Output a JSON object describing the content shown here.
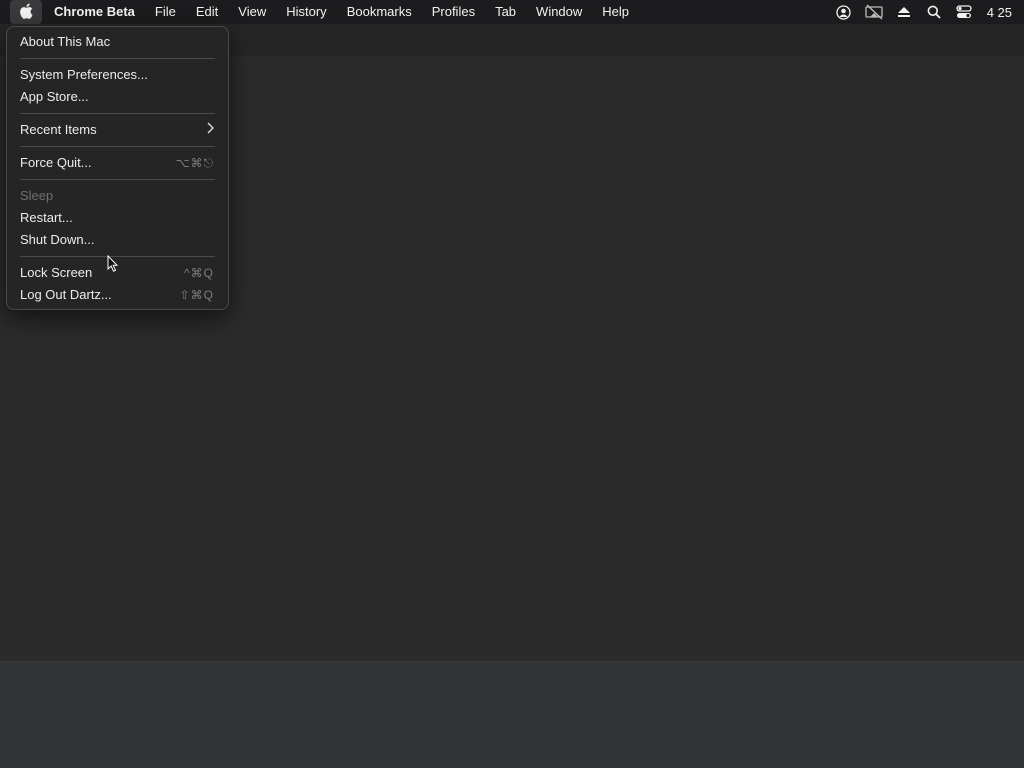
{
  "menubar": {
    "app_name": "Chrome Beta",
    "menus": [
      "File",
      "Edit",
      "View",
      "History",
      "Bookmarks",
      "Profiles",
      "Tab",
      "Window",
      "Help"
    ],
    "status_icons": [
      "user-account-icon",
      "screen-mirroring-off-icon",
      "eject-icon",
      "spotlight-search-icon",
      "control-center-icon"
    ],
    "clock": "4 25"
  },
  "apple_menu": {
    "about": "About This Mac",
    "system_preferences": "System Preferences...",
    "app_store": "App Store...",
    "recent_items": "Recent Items",
    "force_quit": "Force Quit...",
    "force_quit_shortcut": "⌥⌘⎋",
    "sleep": "Sleep",
    "restart": "Restart...",
    "shut_down": "Shut Down...",
    "lock_screen": "Lock Screen",
    "lock_screen_shortcut": "^⌘Q",
    "log_out": "Log Out Dartz...",
    "log_out_shortcut": "⇧⌘Q"
  },
  "colors": {
    "menubar_bg": "#1c1c1e",
    "menu_bg": "#252526",
    "disabled_text": "#6f6f71"
  }
}
